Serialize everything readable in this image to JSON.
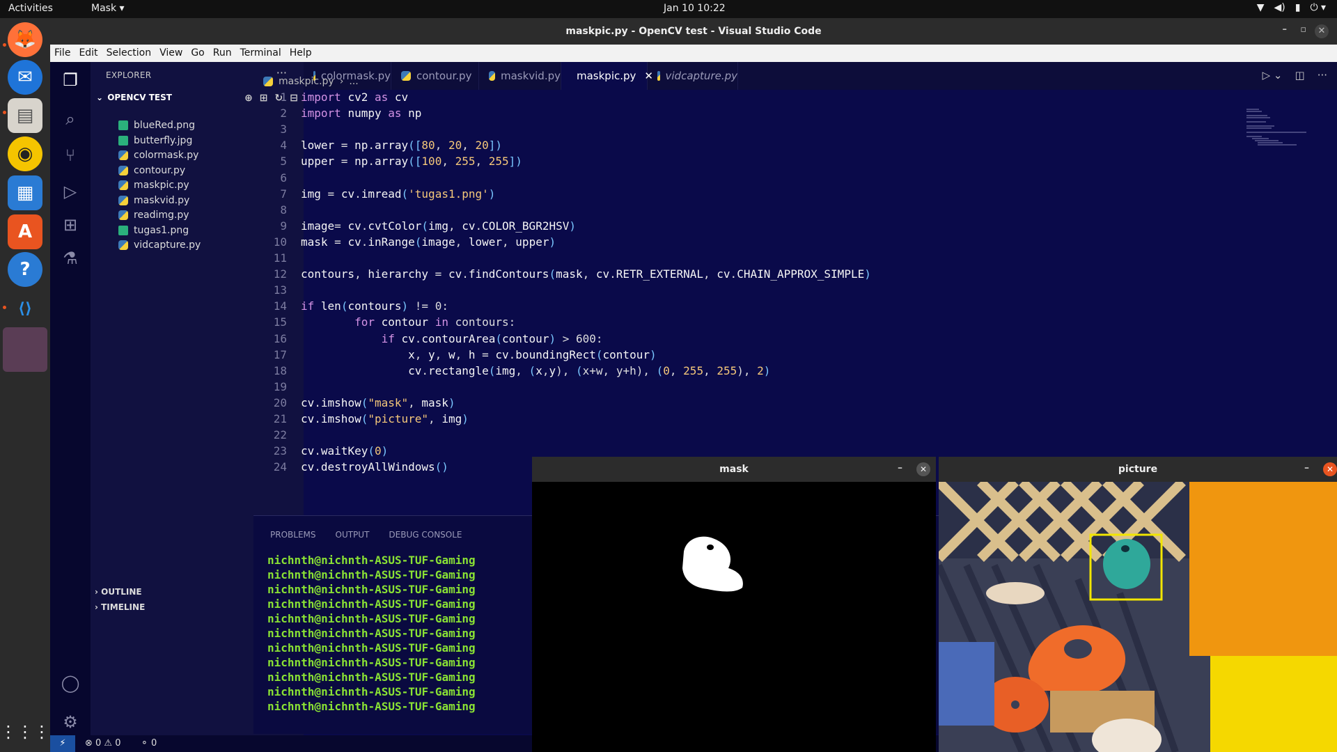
{
  "topbar": {
    "activities": "Activities",
    "app": "Mask ▾",
    "clock": "Jan 10  10:22",
    "tray": [
      "wifi-icon",
      "volume-icon",
      "battery-icon",
      "power-icon"
    ],
    "tray_glyphs": [
      "▼",
      "◀)",
      "▮",
      "⏻ ▾"
    ]
  },
  "window": {
    "title": "maskpic.py - OpenCV test - Visual Studio Code",
    "min": "–",
    "max": "▫",
    "close": "✕"
  },
  "menu": [
    "File",
    "Edit",
    "Selection",
    "View",
    "Go",
    "Run",
    "Terminal",
    "Help"
  ],
  "explorer": {
    "header": "EXPLORER",
    "more": "···",
    "project": "OPENCV TEST",
    "tools": [
      "⊕",
      "⊞",
      "↻",
      "⊟"
    ],
    "files": [
      {
        "name": "blueRed.png",
        "type": "img"
      },
      {
        "name": "butterfly.jpg",
        "type": "img"
      },
      {
        "name": "colormask.py",
        "type": "py"
      },
      {
        "name": "contour.py",
        "type": "py"
      },
      {
        "name": "maskpic.py",
        "type": "py"
      },
      {
        "name": "maskvid.py",
        "type": "py"
      },
      {
        "name": "readimg.py",
        "type": "py"
      },
      {
        "name": "tugas1.png",
        "type": "img"
      },
      {
        "name": "vidcapture.py",
        "type": "py"
      }
    ],
    "outline": "OUTLINE",
    "timeline": "TIMELINE"
  },
  "tabs": [
    {
      "label": "colormask.py",
      "active": false,
      "italic": false
    },
    {
      "label": "contour.py",
      "active": false,
      "italic": false
    },
    {
      "label": "maskvid.py",
      "active": false,
      "italic": false
    },
    {
      "label": "maskpic.py",
      "active": true,
      "italic": false
    },
    {
      "label": "vidcapture.py",
      "active": false,
      "italic": true
    }
  ],
  "tab_close": "✕",
  "tab_actions": [
    "▷ ⌄",
    "◫",
    "···"
  ],
  "breadcrumb": {
    "file": "maskpic.py",
    "sep": "›",
    "rest": "..."
  },
  "code_lines": [
    "import cv2 as cv",
    "import numpy as np",
    "",
    "lower = np.array([80, 20, 20])",
    "upper = np.array([100, 255, 255])",
    "",
    "img = cv.imread('tugas1.png')",
    "",
    "image= cv.cvtColor(img, cv.COLOR_BGR2HSV)",
    "mask = cv.inRange(image, lower, upper)",
    "",
    "contours, hierarchy = cv.findContours(mask, cv.RETR_EXTERNAL, cv.CHAIN_APPROX_SIMPLE)",
    "",
    "if len(contours) != 0:",
    "        for contour in contours:",
    "            if cv.contourArea(contour) > 600:",
    "                x, y, w, h = cv.boundingRect(contour)",
    "                cv.rectangle(img, (x,y), (x+w, y+h), (0, 255, 255), 2)",
    "",
    "cv.imshow(\"mask\", mask)",
    "cv.imshow(\"picture\", img)",
    "",
    "cv.waitKey(0)",
    "cv.destroyAllWindows()"
  ],
  "panel": {
    "tabs": [
      "PROBLEMS",
      "OUTPUT",
      "DEBUG CONSOLE"
    ],
    "terminal_line": "nichnth@nichnth-ASUS-TUF-Gaming",
    "terminal_count": 11
  },
  "status": {
    "remote": "⚡",
    "errors": "⊗ 0 ⚠ 0",
    "ports": "⚬ 0"
  },
  "cv_windows": {
    "mask": {
      "title": "mask",
      "min": "–",
      "close": "✕"
    },
    "picture": {
      "title": "picture",
      "min": "–",
      "close": "✕"
    }
  },
  "dock": [
    "firefox-icon",
    "thunderbird-icon",
    "files-icon",
    "rhythmbox-icon",
    "writer-icon",
    "appcenter-icon",
    "help-icon",
    "vscode-icon",
    "running-app-icon"
  ],
  "dock_glyphs": [
    "🦊",
    "✉",
    "▤",
    "◉",
    "▦",
    "A",
    "?",
    "⟨⟩",
    ""
  ],
  "colors": {
    "accent": "#e95420",
    "editor_bg": "#0a0a4a",
    "terminal_green": "#8ae234",
    "bbox_yellow": "#f2e600"
  }
}
